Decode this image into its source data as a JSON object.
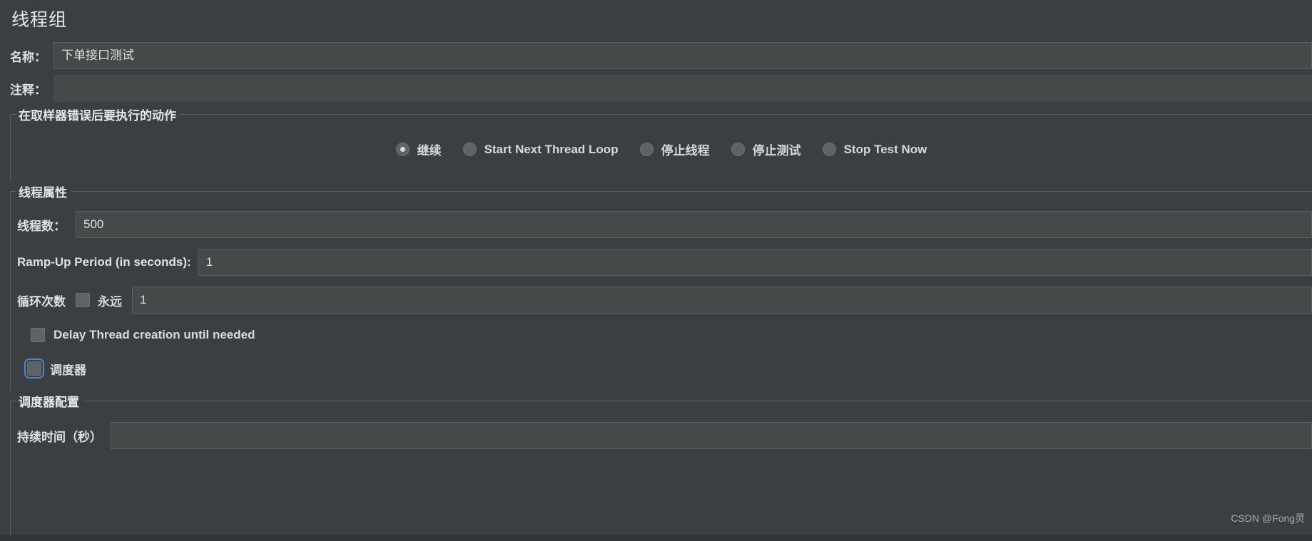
{
  "window": {
    "title": "线程组"
  },
  "name_field": {
    "label": "名称：",
    "value": "下单接口测试",
    "placeholder": ""
  },
  "comment_field": {
    "label": "注释：",
    "value": "",
    "placeholder": ""
  },
  "error_action_group": {
    "title": "在取样器错误后要执行的动作",
    "options": [
      {
        "label": "继续",
        "checked": true
      },
      {
        "label": "Start Next Thread Loop",
        "checked": false
      },
      {
        "label": "停止线程",
        "checked": false
      },
      {
        "label": "停止测试",
        "checked": false
      },
      {
        "label": "Stop Test Now",
        "checked": false
      }
    ]
  },
  "thread_properties": {
    "title": "线程属性",
    "threads": {
      "label": "线程数：",
      "value": "500"
    },
    "ramp_up": {
      "label": "Ramp-Up Period (in seconds):",
      "value": "1"
    },
    "loop_count": {
      "label": "循环次数",
      "forever_label": "永远",
      "forever_checked": false,
      "value": "1"
    },
    "delay_thread_creation": {
      "label": "Delay Thread creation until needed",
      "checked": false
    },
    "scheduler": {
      "label": "调度器",
      "checked": false,
      "focused": true
    }
  },
  "scheduler_config": {
    "title": "调度器配置",
    "duration": {
      "label": "持续时间（秒）",
      "value": ""
    }
  },
  "watermark": {
    "text": "CSDN @Fong灵"
  },
  "colors": {
    "background": "#3c3f41",
    "input_background": "#45494a",
    "border": "#5c6063",
    "text": "#d8d8d8",
    "focus_ring": "#4a88c7"
  }
}
